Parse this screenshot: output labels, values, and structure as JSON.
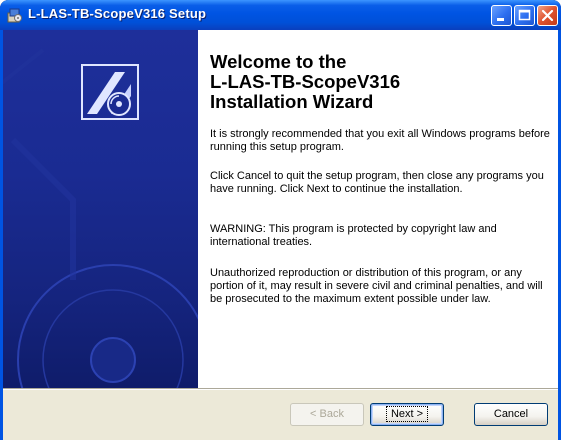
{
  "window": {
    "title": "L-LAS-TB-ScopeV316 Setup",
    "icon": "setup-icon",
    "controls": [
      "minimize-icon",
      "maximize-icon",
      "close-icon"
    ]
  },
  "welcome": {
    "heading_line1": "Welcome to the",
    "heading_line2": "L-LAS-TB-ScopeV316",
    "heading_line3": "Installation Wizard",
    "paragraph1": "It is strongly recommended that you exit all Windows programs before running this setup program.",
    "paragraph2": "Click Cancel to quit the setup program, then close any programs you have running.  Click Next to continue the installation.",
    "paragraph3": "WARNING: This program is protected by copyright law and international treaties.",
    "paragraph4": "Unauthorized reproduction or distribution of this program, or any portion of it, may result in severe civil and criminal penalties, and will be prosecuted to the maximum extent possible under law."
  },
  "buttons": {
    "back": "< Back",
    "next": "Next >",
    "cancel": "Cancel"
  },
  "colors": {
    "titlebar": "#0054e3",
    "side_panel": "#1a2b92",
    "dialog_face": "#ece9d8"
  }
}
